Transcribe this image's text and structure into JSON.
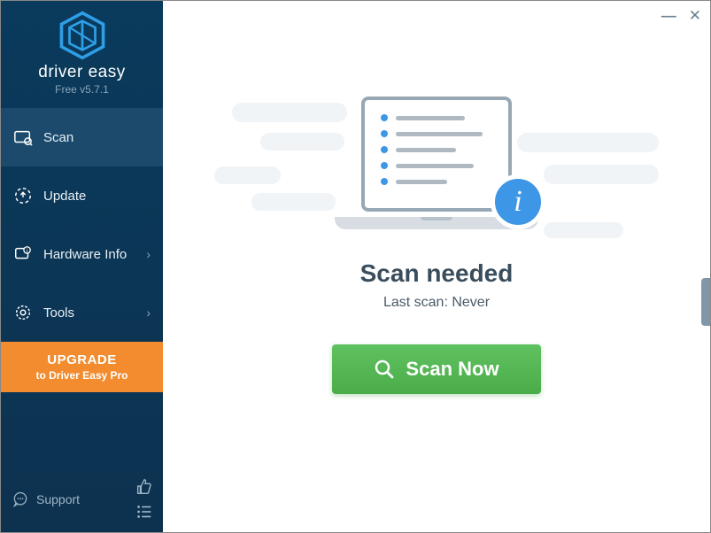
{
  "app": {
    "brand": "driver easy",
    "version": "Free v5.7.1"
  },
  "nav": {
    "scan": "Scan",
    "update": "Update",
    "hardware": "Hardware Info",
    "tools": "Tools"
  },
  "upgrade": {
    "title": "UPGRADE",
    "subtitle": "to Driver Easy Pro"
  },
  "support": {
    "label": "Support"
  },
  "status": {
    "title": "Scan needed",
    "last_scan_label": "Last scan: Never"
  },
  "scan_button": "Scan Now",
  "info_badge": "i"
}
